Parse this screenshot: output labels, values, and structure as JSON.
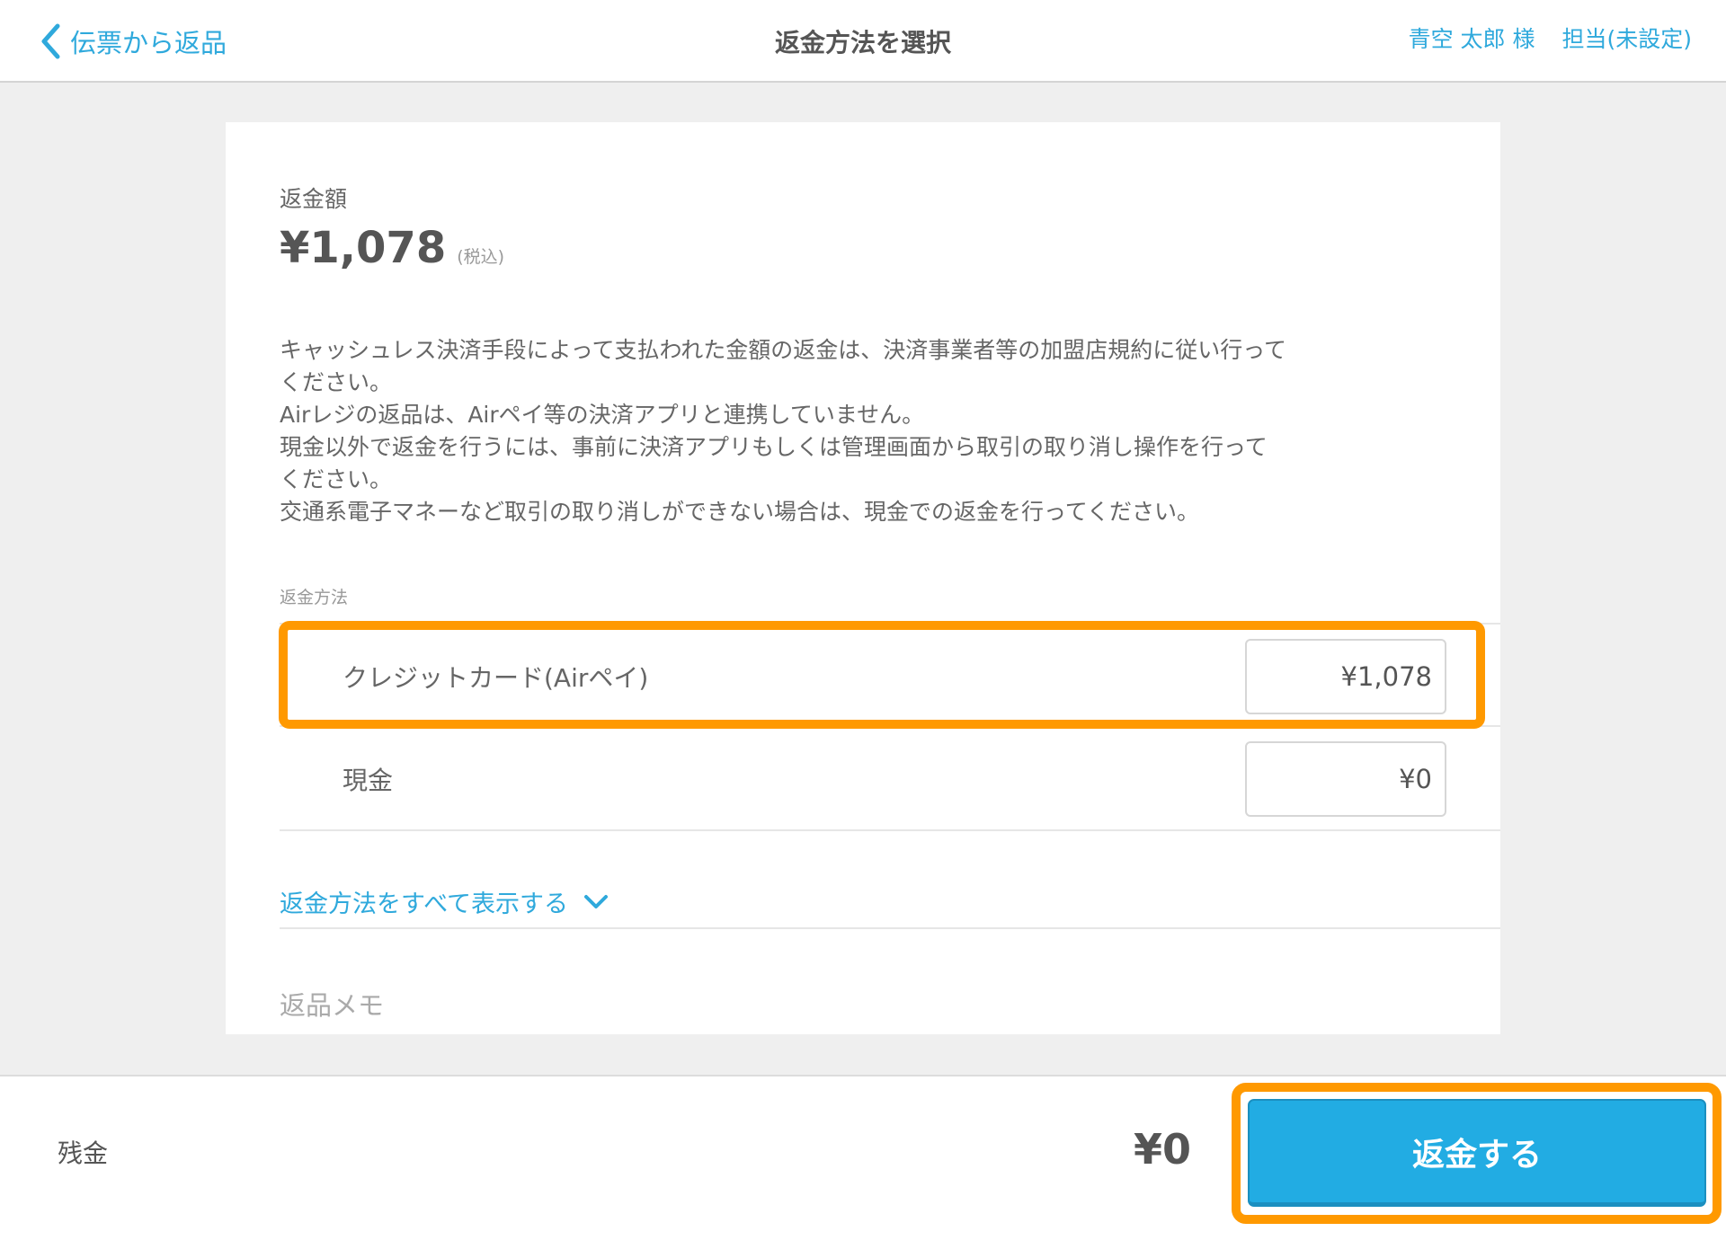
{
  "header": {
    "back_label": "伝票から返品",
    "title": "返金方法を選択",
    "customer": "青空 太郎 様",
    "staff": "担当(未設定)"
  },
  "refund": {
    "amount_label": "返金額",
    "amount": "¥1,078",
    "tax_note": "(税込)"
  },
  "notice": [
    "キャッシュレス決済手段によって支払われた金額の返金は、決済事業者等の加盟店規約に従い行って\nください。",
    "Airレジの返品は、Airペイ等の決済アプリと連携していません。",
    "現金以外で返金を行うには、事前に決済アプリもしくは管理画面から取引の取り消し操作を行って\nください。",
    "交通系電子マネーなど取引の取り消しができない場合は、現金での返金を行ってください。"
  ],
  "methods": {
    "label": "返金方法",
    "items": [
      {
        "name": "クレジットカード(Airペイ)",
        "value": "¥1,078",
        "highlighted": true
      },
      {
        "name": "現金",
        "value": "¥0",
        "highlighted": false
      }
    ],
    "show_all_label": "返金方法をすべて表示する"
  },
  "memo": {
    "label": "返品メモ"
  },
  "footer": {
    "remaining_label": "残金",
    "remaining_value": "¥0",
    "refund_button": "返金する"
  },
  "colors": {
    "accent": "#22ace3",
    "link": "#2fa9dc",
    "highlight": "#ff9900"
  }
}
